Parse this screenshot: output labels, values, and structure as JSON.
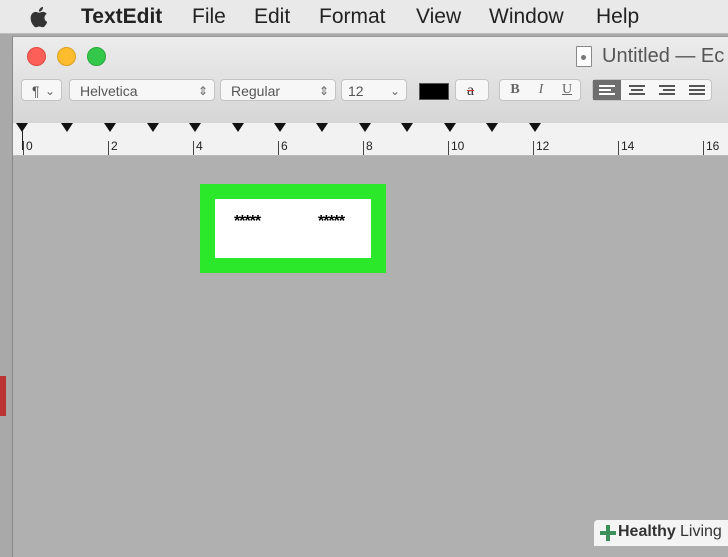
{
  "menubar": {
    "app_name": "TextEdit",
    "items": [
      "File",
      "Edit",
      "Format",
      "View",
      "Window",
      "Help"
    ],
    "apple_icon": "apple-logo-icon"
  },
  "window": {
    "title": "Untitled",
    "title_suffix": "— Ec"
  },
  "toolbar": {
    "paragraph_style": "¶",
    "font_family": "Helvetica",
    "font_style": "Regular",
    "font_size": "12",
    "bold_label": "B",
    "italic_label": "I",
    "underline_label": "U",
    "text_color": "#000000",
    "background_label": "a",
    "alignment_selected": "left"
  },
  "ruler": {
    "labels": [
      "0",
      "2",
      "4",
      "6",
      "8",
      "10",
      "12",
      "14",
      "16"
    ]
  },
  "document": {
    "cell_left": "*****",
    "cell_right": "*****"
  },
  "highlight_color": "#2be82b",
  "watermark": {
    "brand_bold": "Healthy",
    "brand_light": "Living"
  }
}
